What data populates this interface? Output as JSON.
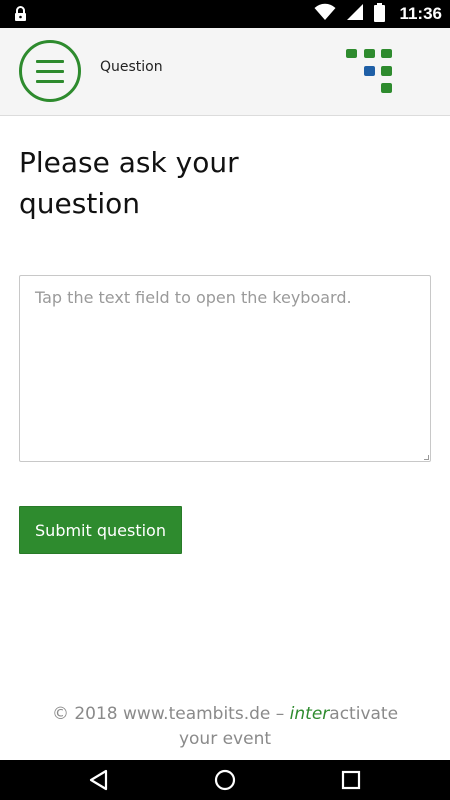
{
  "status_bar": {
    "time": "11:36",
    "icons": [
      "lock-icon",
      "wifi-icon",
      "signal-icon",
      "battery-icon"
    ]
  },
  "app_bar": {
    "title": "Question",
    "menu_icon": "hamburger-menu-icon",
    "logo": "teambits-logo",
    "accent_color": "#2e8b2e",
    "logo_blue": "#1f5fa6"
  },
  "main": {
    "heading": "Please ask your question",
    "question_field": {
      "value": "",
      "placeholder": "Tap the text field to open the keyboard."
    },
    "submit_label": "Submit question"
  },
  "footer": {
    "copyright": "© 2018 www.teambits.de –",
    "accent_word": "inter",
    "rest_word": "activate",
    "tagline": "your event"
  },
  "nav_bar": {
    "icons": [
      "back-icon",
      "home-icon",
      "recents-icon"
    ]
  }
}
